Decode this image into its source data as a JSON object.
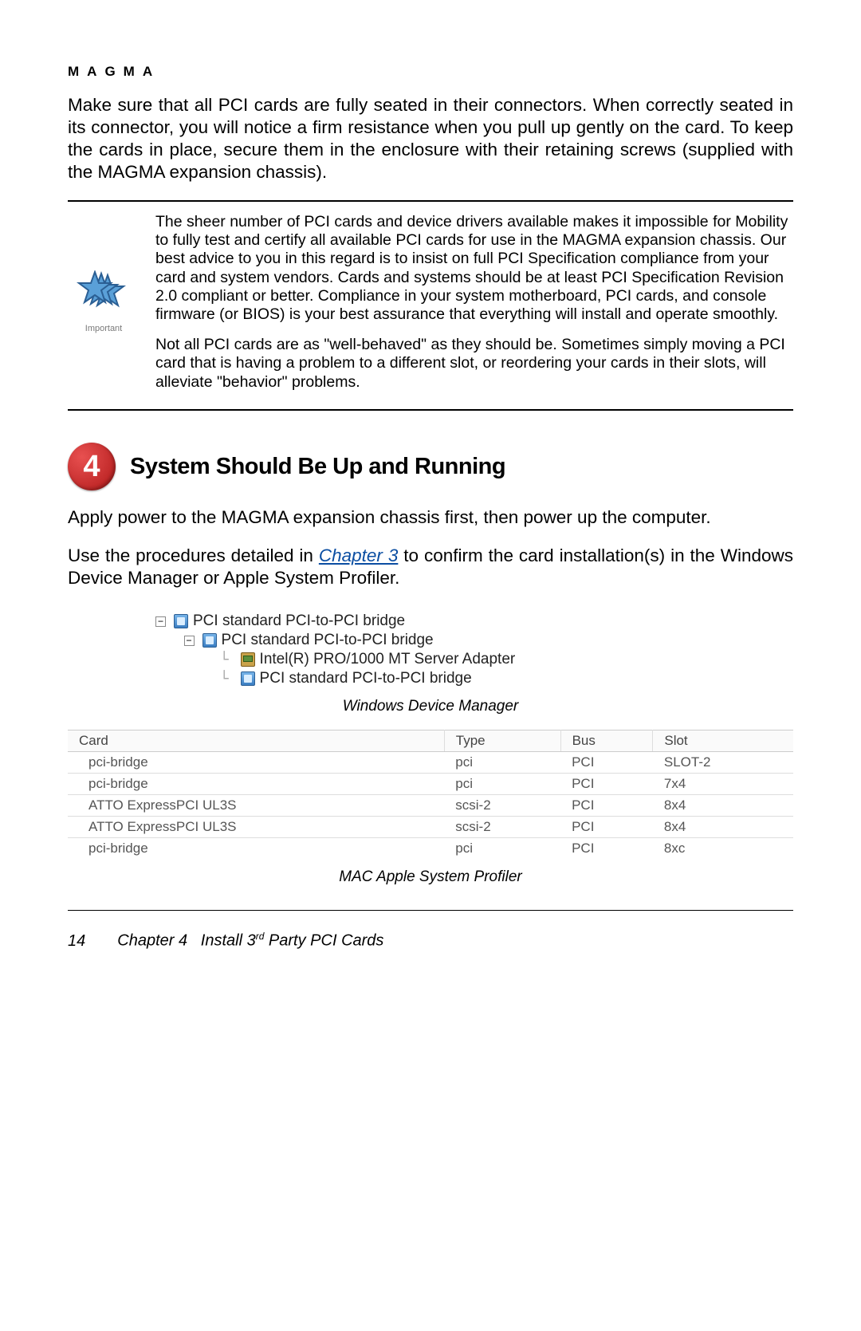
{
  "header": {
    "brand": "MAGMA"
  },
  "intro_para": "Make sure that all PCI cards are fully seated in their connectors. When correctly seated in its connector, you will notice a firm resistance when you pull up gently on the card. To keep the cards in place, secure them in the enclosure with their retaining screws (supplied with the MAGMA expansion chassis).",
  "callout": {
    "icon_label": "Important",
    "para1": "The sheer number of PCI cards and device drivers available makes it impossible for Mobility to fully test and certify all available PCI cards for use in the MAGMA expansion chassis. Our best advice to you in this regard is to insist on full PCI Specification compliance from your card and system vendors. Cards and systems should be at least PCI Specification Revision 2.0 compliant or better. Compliance in your system motherboard, PCI cards, and console firmware (or BIOS) is your best assurance that everything will install and operate smoothly.",
    "para2": "Not all PCI cards are as \"well-behaved\" as they should be. Sometimes simply moving a PCI card that is having a problem to a different slot, or reordering your cards in their slots, will alleviate \"behavior\" problems."
  },
  "section": {
    "step_number": "4",
    "title": "System Should Be Up and Running",
    "para1": "Apply power to the MAGMA expansion chassis first, then power up the computer.",
    "para2_before": "Use the procedures detailed in ",
    "para2_link": "Chapter 3",
    "para2_after": " to confirm the card installation(s) in the Windows Device Manager or Apple System Profiler."
  },
  "device_tree": {
    "items": [
      {
        "indent": 0,
        "expander": "−",
        "icon": "chip",
        "label": "PCI standard PCI-to-PCI bridge"
      },
      {
        "indent": 1,
        "expander": "−",
        "icon": "chip",
        "label": "PCI standard PCI-to-PCI bridge"
      },
      {
        "indent": 2,
        "expander": "",
        "icon": "nic",
        "label": "Intel(R) PRO/1000 MT Server Adapter"
      },
      {
        "indent": 2,
        "expander": "",
        "icon": "chip",
        "label": "PCI standard PCI-to-PCI bridge"
      }
    ],
    "caption": "Windows Device Manager"
  },
  "profiler": {
    "headers": [
      "Card",
      "Type",
      "Bus",
      "Slot"
    ],
    "rows": [
      [
        "pci-bridge",
        "pci",
        "PCI",
        "SLOT-2"
      ],
      [
        "pci-bridge",
        "pci",
        "PCI",
        "7x4"
      ],
      [
        "ATTO ExpressPCI UL3S",
        "scsi-2",
        "PCI",
        "8x4"
      ],
      [
        "ATTO ExpressPCI UL3S",
        "scsi-2",
        "PCI",
        "8x4"
      ],
      [
        "pci-bridge",
        "pci",
        "PCI",
        "8xc"
      ]
    ],
    "caption": "MAC Apple System Profiler"
  },
  "footer": {
    "page_number": "14",
    "chapter_prefix": "Chapter 4",
    "title_before": "Install 3",
    "title_ord": "rd",
    "title_after": " Party PCI Cards"
  }
}
